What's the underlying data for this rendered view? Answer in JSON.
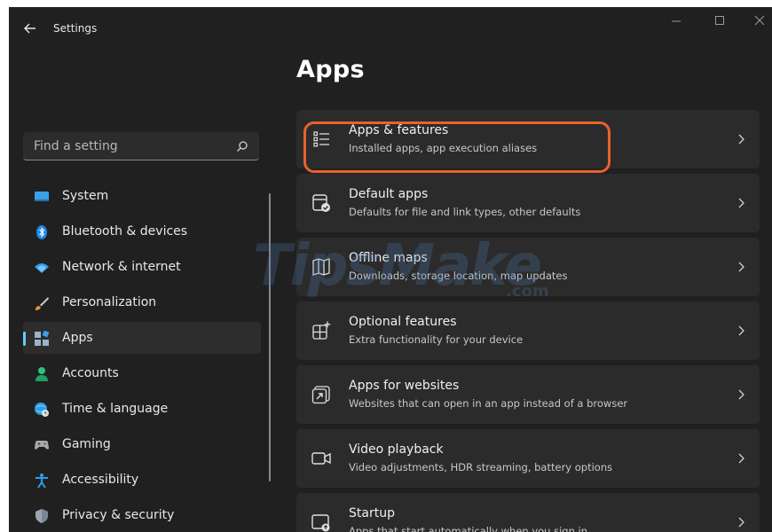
{
  "window": {
    "title": "Settings",
    "controls": [
      "minimize-icon",
      "maximize-icon",
      "close-icon"
    ]
  },
  "search": {
    "placeholder": "Find a setting",
    "icon": "search-icon"
  },
  "sidebar": {
    "accent_color": "#60cdff",
    "items": [
      {
        "label": "System",
        "icon": "system-icon",
        "active": false
      },
      {
        "label": "Bluetooth & devices",
        "icon": "bluetooth-icon",
        "active": false
      },
      {
        "label": "Network & internet",
        "icon": "wifi-icon",
        "active": false
      },
      {
        "label": "Personalization",
        "icon": "brush-icon",
        "active": false
      },
      {
        "label": "Apps",
        "icon": "apps-icon",
        "active": true
      },
      {
        "label": "Accounts",
        "icon": "person-icon",
        "active": false
      },
      {
        "label": "Time & language",
        "icon": "globe-clock-icon",
        "active": false
      },
      {
        "label": "Gaming",
        "icon": "gamepad-icon",
        "active": false
      },
      {
        "label": "Accessibility",
        "icon": "accessibility-icon",
        "active": false
      },
      {
        "label": "Privacy & security",
        "icon": "shield-icon",
        "active": false
      }
    ]
  },
  "main": {
    "title": "Apps",
    "cards": [
      {
        "title": "Apps & features",
        "subtitle": "Installed apps, app execution aliases",
        "icon": "list-icon"
      },
      {
        "title": "Default apps",
        "subtitle": "Defaults for file and link types, other defaults",
        "icon": "default-apps-icon"
      },
      {
        "title": "Offline maps",
        "subtitle": "Downloads, storage location, map updates",
        "icon": "map-icon"
      },
      {
        "title": "Optional features",
        "subtitle": "Extra functionality for your device",
        "icon": "add-grid-icon"
      },
      {
        "title": "Apps for websites",
        "subtitle": "Websites that can open in an app instead of a browser",
        "icon": "open-in-app-icon"
      },
      {
        "title": "Video playback",
        "subtitle": "Video adjustments, HDR streaming, battery options",
        "icon": "video-icon"
      },
      {
        "title": "Startup",
        "subtitle": "Apps that start automatically when you sign in",
        "icon": "startup-icon"
      }
    ],
    "highlight_color": "#e8622c"
  },
  "watermark": {
    "text": "TipsMake",
    "suffix": ".com"
  }
}
